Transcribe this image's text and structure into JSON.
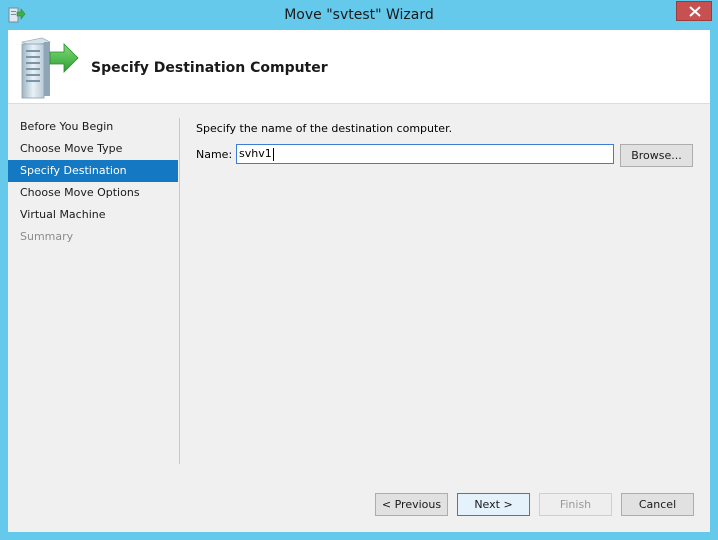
{
  "window": {
    "title": "Move \"svtest\" Wizard"
  },
  "header": {
    "title": "Specify Destination Computer"
  },
  "nav": {
    "items": [
      {
        "label": "Before You Begin"
      },
      {
        "label": "Choose Move Type"
      },
      {
        "label": "Specify Destination"
      },
      {
        "label": "Choose Move Options"
      },
      {
        "label": "Virtual Machine"
      },
      {
        "label": "Summary"
      }
    ],
    "active_label": "Specify Destination"
  },
  "content": {
    "instruction": "Specify the name of the destination computer.",
    "name_label": "Name:",
    "name_value": "svhv1",
    "browse_label": "Browse..."
  },
  "footer": {
    "previous_label": "< Previous",
    "next_label": "Next >",
    "finish_label": "Finish",
    "cancel_label": "Cancel"
  },
  "colors": {
    "titlebar": "#65c9ec",
    "selection": "#1479c2",
    "close_button": "#c75050"
  },
  "icons": {
    "title": "wizard-app-icon",
    "header": "server-move-icon",
    "close": "close-icon"
  }
}
